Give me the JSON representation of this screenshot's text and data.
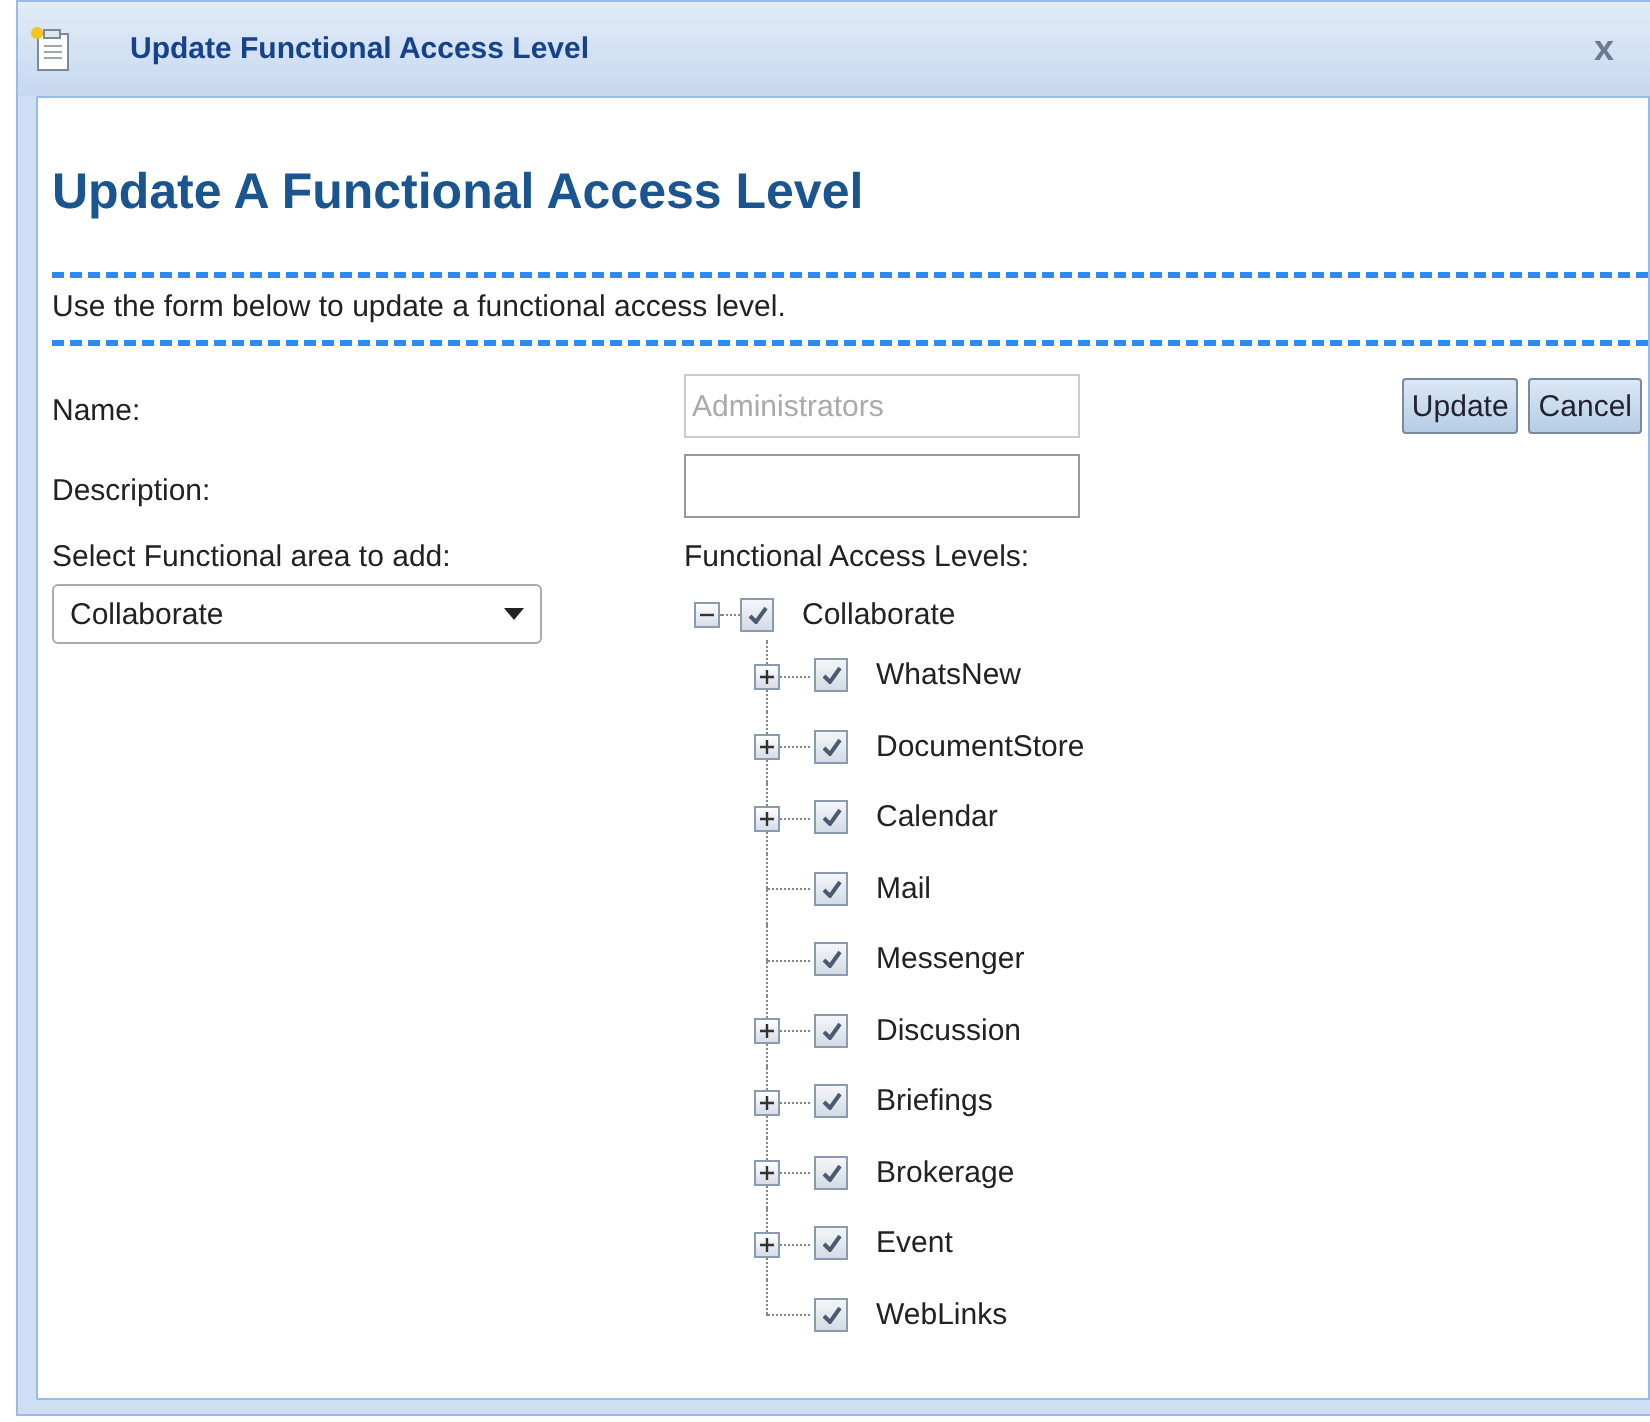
{
  "window": {
    "title": "Update Functional Access Level",
    "close": "x"
  },
  "heading": "Update A Functional Access Level",
  "intro": "Use the form below to update a functional access level.",
  "form": {
    "name_label": "Name:",
    "name_value": "Administrators",
    "name_disabled": true,
    "description_label": "Description:",
    "area_label": "Select Functional area to add:",
    "area_value": "Collaborate",
    "tree_label": "Functional Access Levels:"
  },
  "buttons": [
    "Update",
    "Cancel"
  ],
  "tree": {
    "label": "Collaborate",
    "checked": true,
    "expanded": true,
    "children": [
      {
        "label": "WhatsNew",
        "checked": true,
        "expanded": false
      },
      {
        "label": "DocumentStore",
        "checked": true,
        "expanded": false
      },
      {
        "label": "Calendar",
        "checked": true,
        "expanded": false
      },
      {
        "label": "Mail",
        "checked": true
      },
      {
        "label": "Messenger",
        "checked": true
      },
      {
        "label": "Discussion",
        "checked": true,
        "expanded": false
      },
      {
        "label": "Briefings",
        "checked": true,
        "expanded": false
      },
      {
        "label": "Brokerage",
        "checked": true,
        "expanded": false
      },
      {
        "label": "Event",
        "checked": true,
        "expanded": false
      },
      {
        "label": "WebLinks",
        "checked": true
      }
    ]
  }
}
